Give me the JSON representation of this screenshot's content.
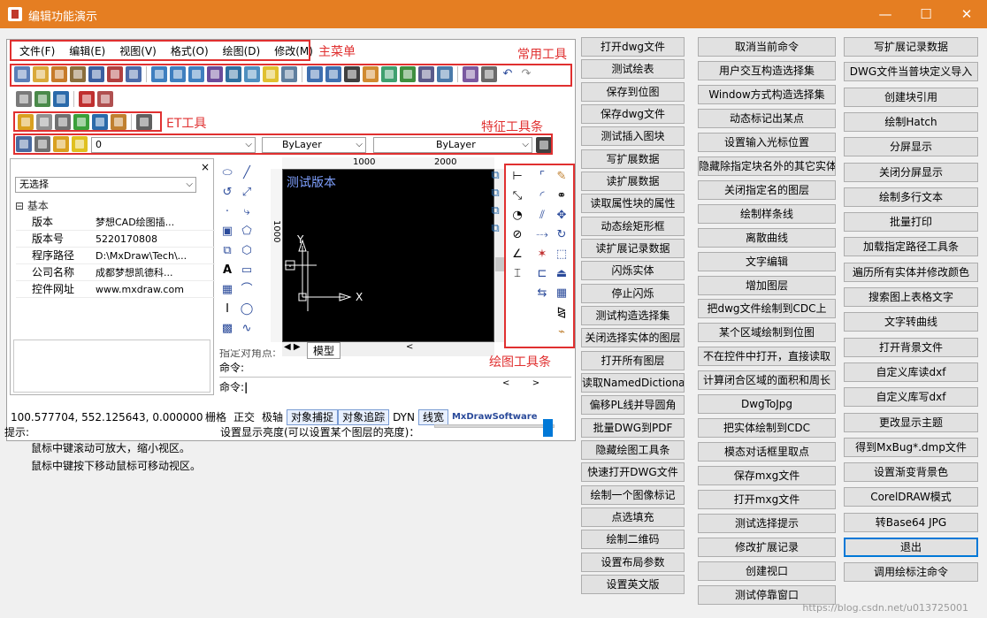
{
  "window": {
    "title": "编辑功能演示",
    "controls": {
      "minimize": "—",
      "maximize": "☐",
      "close": "✕"
    }
  },
  "colors": {
    "titlebar": "#e57e22",
    "annotation": "#e03030",
    "accent": "#0078d7"
  },
  "menubar": {
    "items": [
      "文件(F)",
      "编辑(E)",
      "视图(V)",
      "格式(O)",
      "绘图(D)",
      "修改(M)"
    ]
  },
  "annotations": {
    "main_menu": "主菜单",
    "common_tools": "常用工具",
    "et_tools": "ET工具",
    "feature_toolbar": "特征工具条",
    "drawing_toolbar": "绘图工具条"
  },
  "layer_bar": {
    "layer_value": "0",
    "color_value": "ByLayer",
    "linetype_value": "ByLayer"
  },
  "properties": {
    "close": "×",
    "selection": "无选择",
    "section": "基本",
    "rows": [
      {
        "name": "版本",
        "value": "梦想CAD绘图插..."
      },
      {
        "name": "版本号",
        "value": "5220170808"
      },
      {
        "name": "程序路径",
        "value": "D:\\MxDraw\\Tech\\..."
      },
      {
        "name": "公司名称",
        "value": "成都梦想凯德科..."
      },
      {
        "name": "控件网址",
        "value": "www.mxdraw.com"
      }
    ]
  },
  "canvas": {
    "version_text": "测试版本",
    "ruler_top": [
      "1000",
      "2000"
    ],
    "ruler_left": [
      "1000"
    ],
    "axis_x": "X",
    "axis_y": "Y",
    "tab_model": "模型"
  },
  "command": {
    "line1": "指定对角点:",
    "line2": "命令:",
    "line3": "命令:"
  },
  "statusbar": {
    "coords": "100.577704,  552.125643,  0.000000",
    "toggles": [
      "栅格",
      "正交",
      "极轴",
      "对象捕捉",
      "对象追踪",
      "DYN",
      "线宽"
    ],
    "active": [
      "对象捕捉",
      "对象追踪",
      "线宽"
    ],
    "brand": "MxDrawSoftware"
  },
  "tips": {
    "title": "提示:",
    "line1": "鼠标中键滚动可放大，缩小视区。",
    "line2": "鼠标中键按下移动鼠标可移动视区。",
    "brightness_label": "设置显示亮度(可以设置某个图层的亮度)："
  },
  "buttons": {
    "col1": [
      "打开dwg文件",
      "测试绘表",
      "保存到位图",
      "保存dwg文件",
      "测试插入图块",
      "写扩展数据",
      "读扩展数据",
      "读取属性块的属性",
      "动态绘矩形框",
      "读扩展记录数据",
      "闪烁实体",
      "停止闪烁",
      "测试构造选择集",
      "关闭选择实体的图层",
      "打开所有图层",
      "读取NamedDictionary",
      "偏移PL线并导圆角",
      "批量DWG到PDF",
      "隐藏绘图工具条",
      "快速打开DWG文件",
      "绘制一个图像标记",
      "点选填充",
      "绘制二维码",
      "设置布局参数",
      "设置英文版"
    ],
    "col2": [
      "取消当前命令",
      "用户交互构造选择集",
      "Window方式构造选择集",
      "动态标记出某点",
      "设置输入光标位置",
      "隐藏除指定块名外的其它实体",
      "关闭指定名的图层",
      "绘制样条线",
      "离散曲线",
      "文字编辑",
      "增加图层",
      "把dwg文件绘制到CDC上",
      "某个区域绘制到位图",
      "不在控件中打开，直接读取",
      "计算闭合区域的面积和周长",
      "DwgToJpg",
      "把实体绘制到CDC",
      "模态对话框里取点",
      "保存mxg文件",
      "打开mxg文件",
      "测试选择提示",
      "修改扩展记录",
      "创建视口",
      "测试停靠窗口"
    ],
    "col3": [
      "写扩展记录数据",
      "DWG文件当普块定义导入",
      "创建块引用",
      "绘制Hatch",
      "分屏显示",
      "关闭分屏显示",
      "绘制多行文本",
      "批量打印",
      "加载指定路径工具条",
      "遍历所有实体并修改颜色",
      "搜索图上表格文字",
      "文字转曲线",
      "打开背景文件",
      "自定义库读dxf",
      "自定义库写dxf",
      "更改显示主题",
      "得到MxBug*.dmp文件",
      "设置渐变背景色",
      "CorelDRAW模式",
      "转Base64 JPG",
      "退出",
      "调用绘标注命令"
    ]
  },
  "watermark": "https://blog.csdn.net/u013725001"
}
